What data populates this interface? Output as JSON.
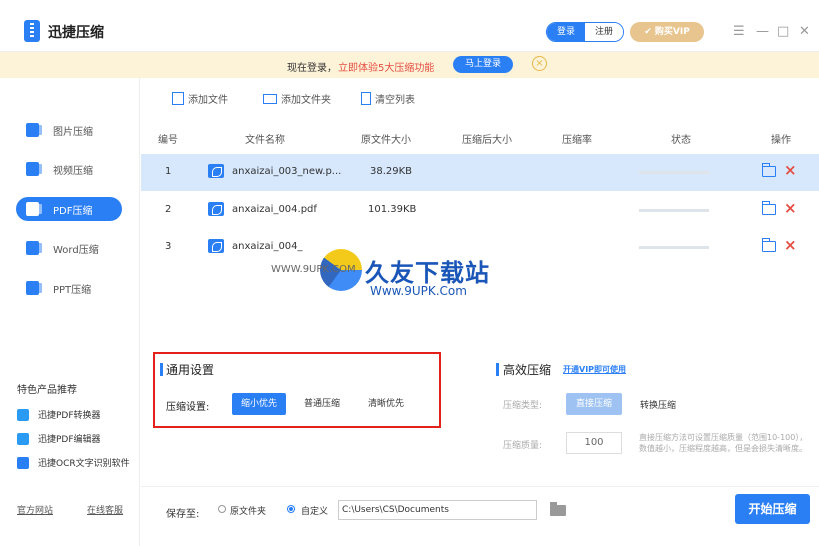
{
  "app": {
    "title": "迅捷压缩",
    "logo_icon": "zip-logo-icon"
  },
  "header": {
    "login_label": "登录",
    "register_label": "注册",
    "vip_label": "购买VIP",
    "menu_glyph": "☰",
    "minimize_glyph": "—",
    "maximize_glyph": "□",
    "close_glyph": "✕"
  },
  "notice": {
    "text": "现在登录，",
    "link": "立即体验5大压缩功能",
    "login_button": "马上登录",
    "close_glyph": "×"
  },
  "sidebar": {
    "items": [
      {
        "label": "图片压缩",
        "icon": "image-compress-icon",
        "color": "#2b7ff5"
      },
      {
        "label": "视频压缩",
        "icon": "video-compress-icon",
        "color": "#2b7ff5"
      },
      {
        "label": "PDF压缩",
        "icon": "pdf-compress-icon",
        "color": "#ffffff",
        "active": true
      },
      {
        "label": "Word压缩",
        "icon": "word-compress-icon",
        "color": "#2b7ff5"
      },
      {
        "label": "PPT压缩",
        "icon": "ppt-compress-icon",
        "color": "#2b7ff5"
      }
    ],
    "promo_title": "特色产品推荐",
    "promos": [
      {
        "label": "迅捷PDF转换器",
        "color": "#2b9af3"
      },
      {
        "label": "迅捷PDF编辑器",
        "color": "#2b9af3"
      },
      {
        "label": "迅捷OCR文字识别软件",
        "color": "#2b7ff5"
      }
    ],
    "site_link": "官方网站",
    "support_link": "在线客服"
  },
  "toolbar": {
    "add_file": "添加文件",
    "add_folder": "添加文件夹",
    "clear_list": "清空列表"
  },
  "table": {
    "columns": [
      "编号",
      "文件名称",
      "原文件大小",
      "压缩后大小",
      "压缩率",
      "状态",
      "操作"
    ],
    "rows": [
      {
        "num": "1",
        "name": "anxaizai_003_new.p...",
        "size": "38.29KB",
        "compressed": "",
        "ratio": ""
      },
      {
        "num": "2",
        "name": "anxaizai_004.pdf",
        "size": "101.39KB",
        "compressed": "",
        "ratio": ""
      },
      {
        "num": "3",
        "name": "anxaizai_004_",
        "size": "",
        "compressed": "",
        "ratio": ""
      }
    ]
  },
  "watermark": {
    "title": "久友下载站",
    "url": "Www.9UPK.Com",
    "url_left": "WWW.9UPK.COM"
  },
  "settings": {
    "general_title": "通用设置",
    "compress_label": "压缩设置:",
    "options": [
      "缩小优先",
      "普通压缩",
      "清晰优先"
    ],
    "selected_option": "缩小优先",
    "hq_title": "高效压缩",
    "hq_link": "开通VIP即可使用",
    "type_label": "压缩类型:",
    "type_direct": "直接压缩",
    "type_convert": "转换压缩",
    "quality_label": "压缩质量:",
    "quality_value": "100",
    "quality_desc": "直接压缩方法可设置压缩质量（范围10-100），数值越小，压缩程度越高，但是会损失清晰度。"
  },
  "bottom": {
    "save_label": "保存至:",
    "radio_original": "原文件夹",
    "radio_custom": "自定义",
    "path": "C:\\Users\\CS\\Documents",
    "start_button": "开始压缩"
  },
  "colors": {
    "accent": "#2b7ff5",
    "danger": "#e54d42",
    "vip": "#e8c48e",
    "notice_bg": "#fdf3d8"
  }
}
